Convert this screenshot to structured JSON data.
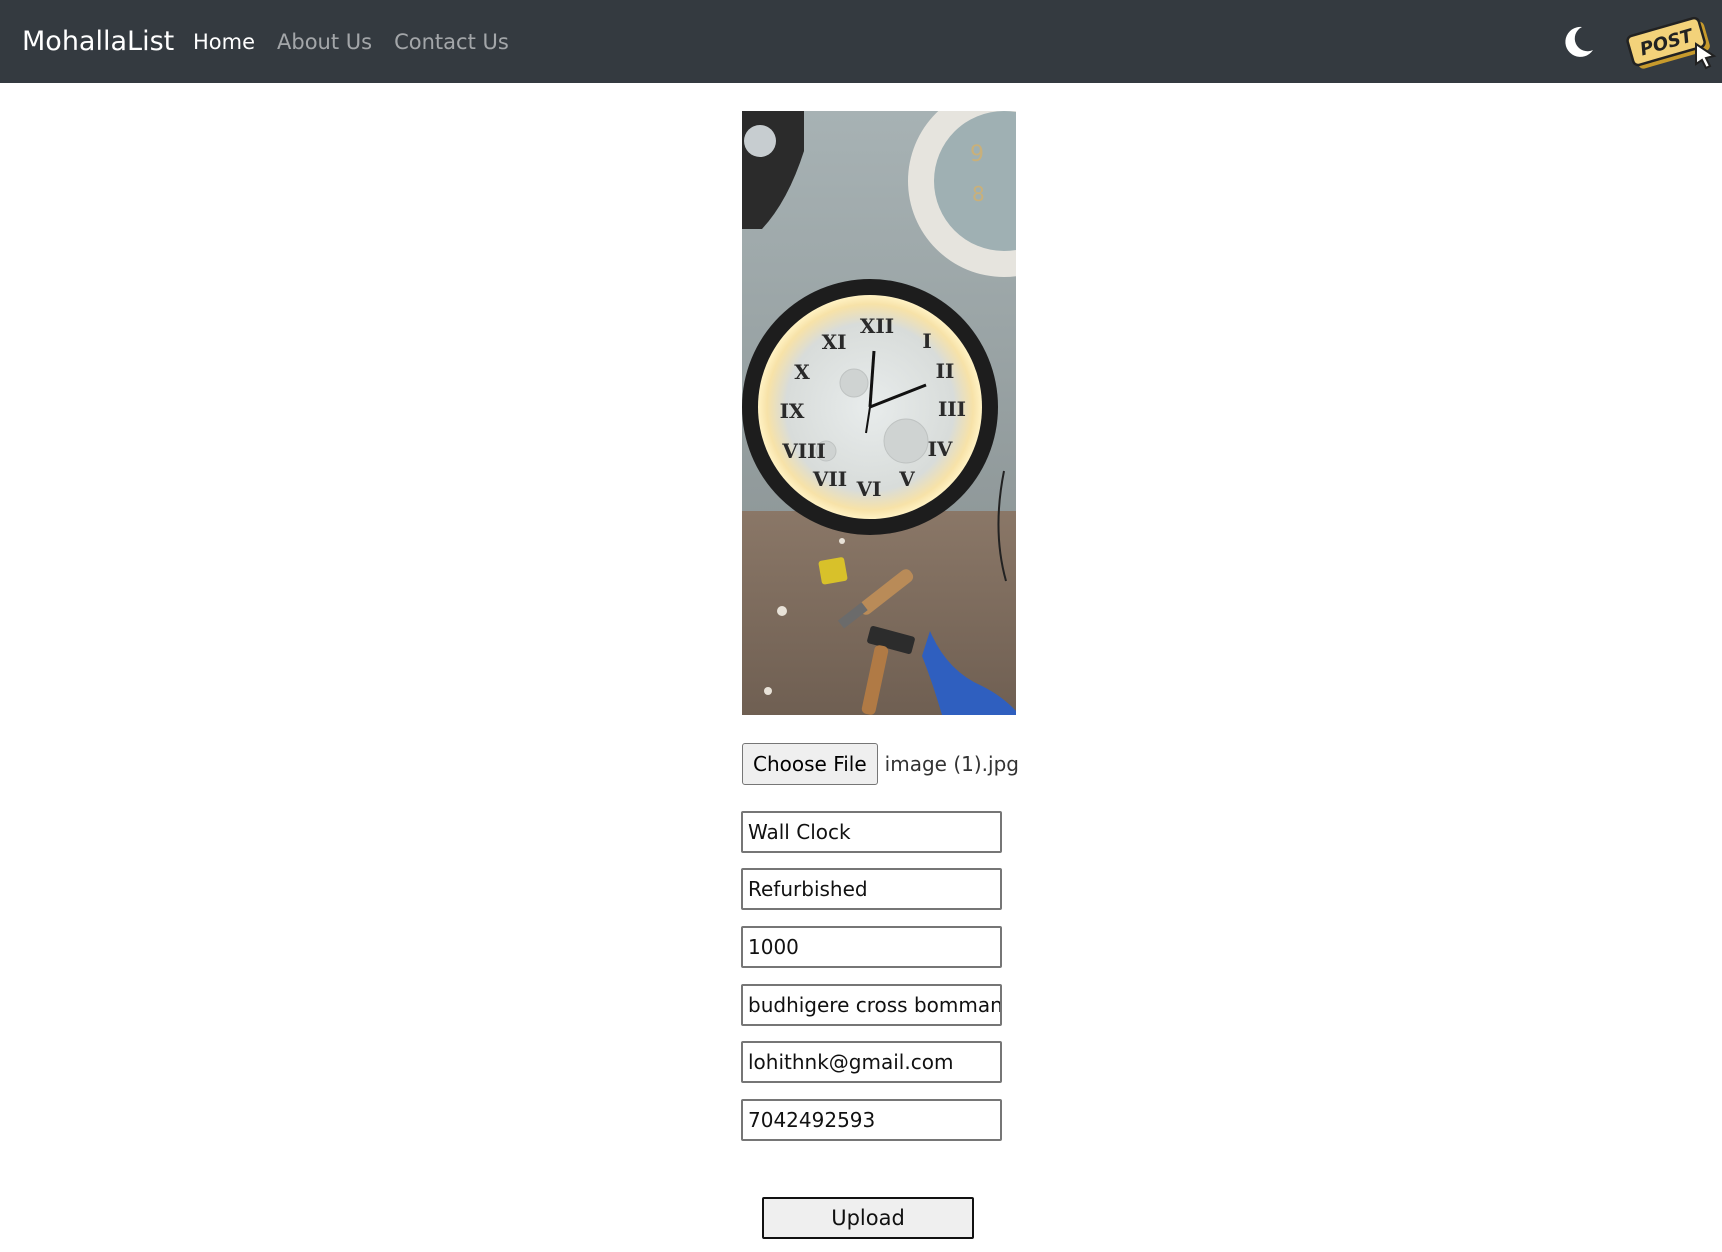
{
  "navbar": {
    "brand": "MohallaList",
    "links": [
      {
        "label": "Home",
        "active": true
      },
      {
        "label": "About Us",
        "active": false
      },
      {
        "label": "Contact Us",
        "active": false
      }
    ],
    "theme_icon": "moon-icon",
    "post_button_label": "POST",
    "colors": {
      "background": "#343a40",
      "post_badge": "#f3d27a"
    }
  },
  "form": {
    "preview_image": "wall-clock-photo",
    "file_input": {
      "button_label": "Choose File",
      "file_name": "image (1).jpg"
    },
    "fields": {
      "title": "Wall Clock",
      "condition": "Refurbished",
      "price": "1000",
      "address": "budhigere cross bomman",
      "email": "lohithnk@gmail.com",
      "phone": "7042492593"
    },
    "upload_label": "Upload"
  }
}
